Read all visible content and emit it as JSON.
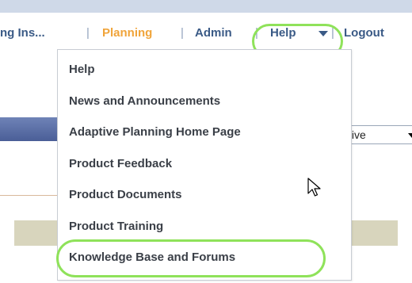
{
  "nav": {
    "item_partial": "ng Ins...",
    "separator": "|",
    "planning": "Planning",
    "admin": "Admin",
    "help": "Help",
    "logout": "Logout"
  },
  "filter_select": {
    "value": "ctive"
  },
  "help_menu": {
    "items": [
      "Help",
      "News and Announcements",
      "Adaptive Planning Home Page",
      "Product Feedback",
      "Product Documents",
      "Product Training",
      "Knowledge Base and Forums"
    ]
  },
  "colors": {
    "nav_link": "#3a5a86",
    "nav_active": "#f0a43a",
    "highlight": "#8fe25a",
    "menu_text": "#3a3f47"
  }
}
